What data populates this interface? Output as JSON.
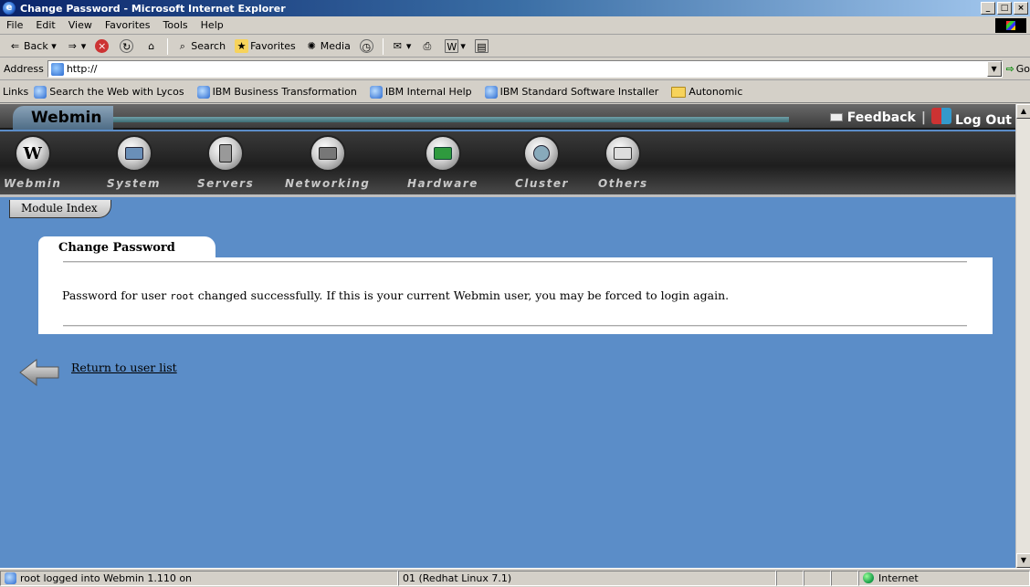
{
  "window": {
    "title": "Change Password - Microsoft Internet Explorer"
  },
  "menu": [
    "File",
    "Edit",
    "View",
    "Favorites",
    "Tools",
    "Help"
  ],
  "toolbar": {
    "back": "Back",
    "search": "Search",
    "favorites": "Favorites",
    "media": "Media"
  },
  "address": {
    "label": "Address",
    "url": "http://",
    "go": "Go"
  },
  "links": {
    "label": "Links",
    "items": [
      "Search the Web with Lycos",
      "IBM Business Transformation",
      "IBM Internal Help",
      "IBM Standard Software Installer"
    ],
    "folder": "Autonomic"
  },
  "webmin": {
    "brand": "Webmin",
    "feedback": "Feedback",
    "logout": "Log Out",
    "categories": [
      "Webmin",
      "System",
      "Servers",
      "Networking",
      "Hardware",
      "Cluster",
      "Others"
    ],
    "module_index": "Module Index"
  },
  "content": {
    "tab_title": "Change Password",
    "message_prefix": "Password for user",
    "message_user": "root",
    "message_suffix": "changed successfully. If this is your current Webmin user, you may be forced to login again.",
    "return_link": "Return to user list"
  },
  "status": {
    "left": "root logged into Webmin 1.110 on",
    "middle": "01 (Redhat Linux 7.1)",
    "zone": "Internet"
  }
}
